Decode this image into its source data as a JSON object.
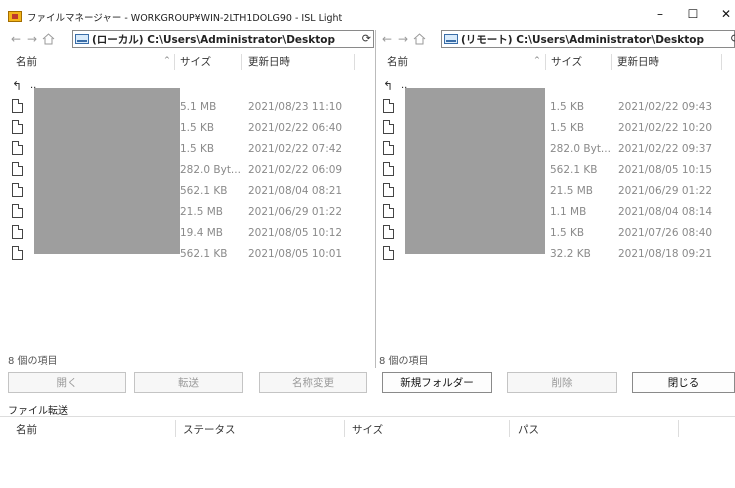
{
  "window": {
    "title": "ファイルマネージャー - WORKGROUP¥WIN-2LTH1DOLG90 - ISL Light",
    "controls": {
      "minimize": "–",
      "maximize": "☐",
      "close": "✕"
    }
  },
  "icons": {
    "back": "arrow-left",
    "forward": "arrow-right",
    "home": "home",
    "refresh": "refresh",
    "up": "up-level",
    "file": "file",
    "drive": "drive"
  },
  "local": {
    "address": "(ローカル) C:\\Users\\Administrator\\Desktop",
    "columns": {
      "name": "名前",
      "size": "サイズ",
      "date": "更新日時"
    },
    "parent": "..",
    "files": [
      {
        "size": "5.1 MB",
        "date": "2021/08/23 11:10"
      },
      {
        "size": "1.5 KB",
        "date": "2021/02/22 06:40"
      },
      {
        "size": "1.5 KB",
        "date": "2021/02/22 07:42"
      },
      {
        "size": "282.0 Byt...",
        "date": "2021/02/22 06:09"
      },
      {
        "size": "562.1 KB",
        "date": "2021/08/04 08:21"
      },
      {
        "size": "21.5 MB",
        "date": "2021/06/29 01:22"
      },
      {
        "size": "19.4 MB",
        "date": "2021/08/05 10:12"
      },
      {
        "size": "562.1 KB",
        "date": "2021/08/05 10:01"
      }
    ],
    "count": "8 個の項目"
  },
  "remote": {
    "address": "(リモート) C:\\Users\\Administrator\\Desktop",
    "columns": {
      "name": "名前",
      "size": "サイズ",
      "date": "更新日時"
    },
    "parent": "..",
    "files": [
      {
        "size": "1.5 KB",
        "date": "2021/02/22 09:43"
      },
      {
        "size": "1.5 KB",
        "date": "2021/02/22 10:20"
      },
      {
        "size": "282.0 Byt...",
        "date": "2021/02/22 09:37"
      },
      {
        "size": "562.1 KB",
        "date": "2021/08/05 10:15"
      },
      {
        "size": "21.5 MB",
        "date": "2021/06/29 01:22"
      },
      {
        "size": "1.1 MB",
        "date": "2021/08/04 08:14"
      },
      {
        "size": "1.5 KB",
        "date": "2021/07/26 08:40"
      },
      {
        "size": "32.2 KB",
        "date": "2021/08/18 09:21"
      }
    ],
    "count": "8 個の項目"
  },
  "buttons": {
    "open": "開く",
    "transfer": "転送",
    "rename": "名称変更",
    "new_folder": "新規フォルダー",
    "delete": "削除",
    "close": "閉じる"
  },
  "transfer": {
    "label": "ファイル転送",
    "columns": {
      "name": "名前",
      "status": "ステータス",
      "size": "サイズ",
      "path": "パス"
    }
  }
}
